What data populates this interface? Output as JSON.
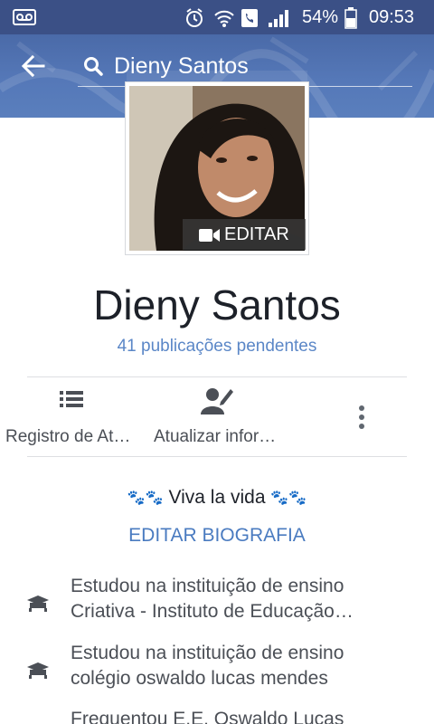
{
  "status_bar": {
    "battery": "54%",
    "time": "09:53"
  },
  "search": {
    "query": "Dieny Santos"
  },
  "profile": {
    "edit_photo_label": "EDITAR",
    "name": "Dieny Santos",
    "pending_posts": "41 publicações pendentes"
  },
  "actions": {
    "activity_log": "Registro de At…",
    "update_info": "Atualizar infor…"
  },
  "bio": {
    "text": "Viva la vida",
    "edit_label": "EDITAR BIOGRAFIA"
  },
  "info_items": [
    {
      "line1": "Estudou na instituição de ensino",
      "line2": "Criativa - Instituto de Educação…"
    },
    {
      "line1": "Estudou na instituição de ensino",
      "line2": "colégio oswaldo lucas mendes"
    },
    {
      "line1": "Frequentou E.E. Oswaldo Lucas",
      "line2": ""
    }
  ],
  "colors": {
    "status_bar": "#3b5086",
    "header": "#5578b8",
    "link": "#4a7bc0"
  }
}
